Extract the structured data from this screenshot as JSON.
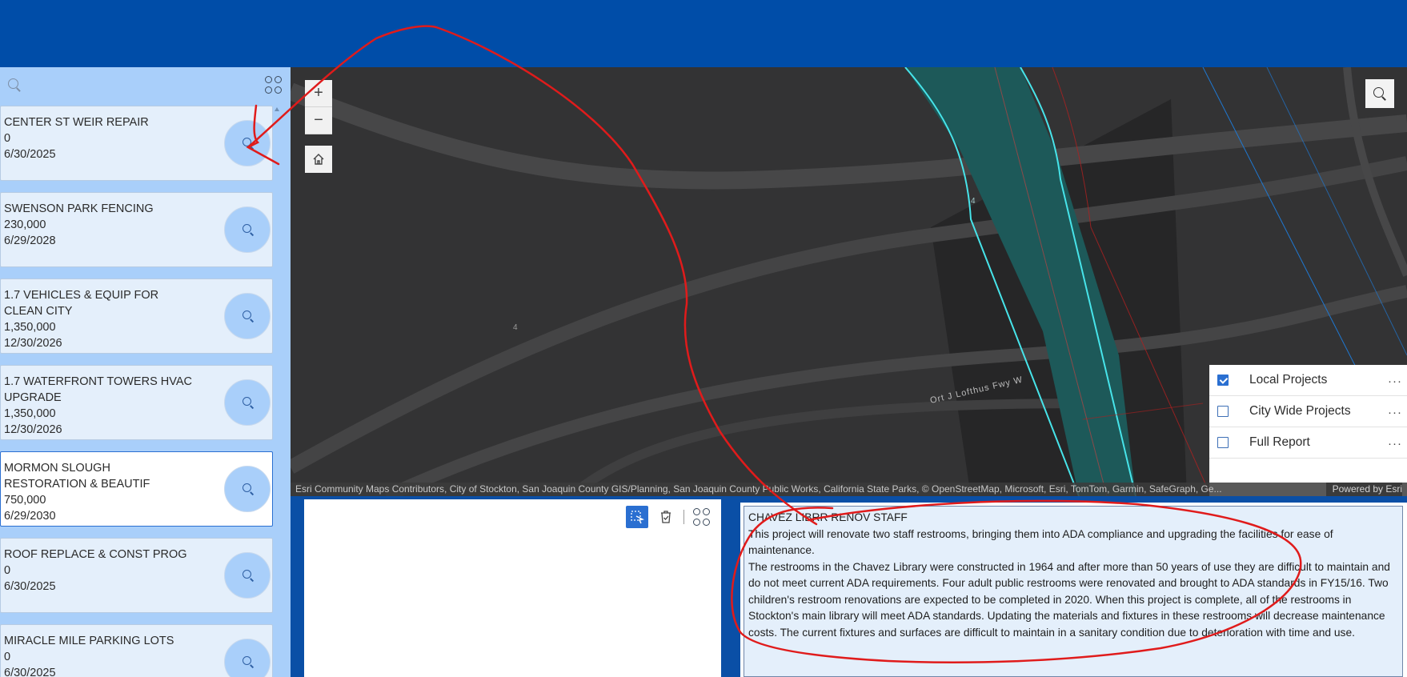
{
  "projects": [
    {
      "title": "CENTER ST WEIR REPAIR",
      "amount": "0",
      "date": "6/30/2025"
    },
    {
      "title": "SWENSON PARK FENCING",
      "amount": "230,000",
      "date": "6/29/2028"
    },
    {
      "title": "1.7 VEHICLES & EQUIP FOR CLEAN CITY",
      "amount": "1,350,000",
      "date": "12/30/2026"
    },
    {
      "title": "1.7 WATERFRONT TOWERS HVAC UPGRADE",
      "amount": "1,350,000",
      "date": "12/30/2026"
    },
    {
      "title": "MORMON SLOUGH RESTORATION & BEAUTIF",
      "amount": "750,000",
      "date": "6/29/2030"
    },
    {
      "title": "ROOF REPLACE & CONST PROG",
      "amount": "0",
      "date": "6/30/2025"
    },
    {
      "title": "MIRACLE MILE PARKING LOTS",
      "amount": "0",
      "date": "6/30/2025"
    }
  ],
  "map": {
    "zoom_in": "+",
    "zoom_out": "−",
    "road_label": "Ort J Lofthus Fwy W",
    "route_marker_1": "4",
    "route_marker_2": "4",
    "attribution": "Esri Community Maps Contributors, City of Stockton, San Joaquin County GIS/Planning, San Joaquin County Public Works, California State Parks, © OpenStreetMap, Microsoft, Esri, TomTom, Garmin, SafeGraph, Ge...",
    "powered_by": "Powered by Esri"
  },
  "layers": [
    {
      "label": "Local Projects",
      "checked": true
    },
    {
      "label": "City Wide Projects",
      "checked": false
    },
    {
      "label": "Full Report",
      "checked": false
    }
  ],
  "layer_menu": "···",
  "detail": {
    "title": "CHAVEZ LIBRR RENOV STAFF",
    "para1": "This project will renovate two staff restrooms, bringing them into ADA compliance and upgrading the facilities for ease of maintenance.",
    "para2": "The restrooms in the Chavez Library were constructed in 1964 and after more than 50 years of use they are difficult to maintain and do not meet current ADA requirements.  Four adult public restrooms were renovated and brought to ADA standards in FY15/16.  Two children's restroom renovations are expected to be completed in 2020.  When this project is complete, all of the restrooms in Stockton's main library will meet ADA standards.  Updating the materials and fixtures in these restrooms will decrease maintenance costs.  The current fixtures and surfaces are difficult to maintain in a sanitary condition due to deterioration with time and use."
  },
  "colors": {
    "header": "#004da8",
    "panel": "#a9cffa",
    "card": "#e4effb",
    "accent": "#2a6fd1",
    "annotation": "#e01b1b"
  }
}
